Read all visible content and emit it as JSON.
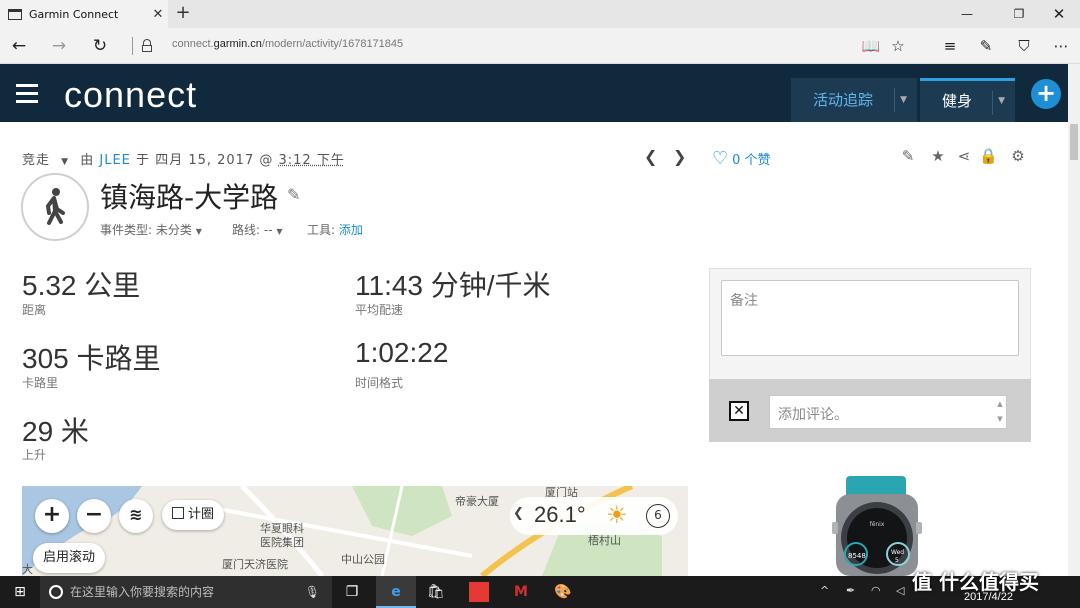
{
  "browser": {
    "tab_title": "Garmin Connect",
    "tab_close": "✕",
    "new_tab": "+",
    "url_prefix": "connect.",
    "url_host": "garmin.cn",
    "url_path": "/modern/activity/1678171845"
  },
  "header": {
    "logo_text": "connect",
    "tabs": [
      {
        "label": "活动追踪"
      },
      {
        "label": "健身"
      }
    ]
  },
  "activity": {
    "type": "竞走",
    "by_label": "由",
    "user": "JLEE",
    "on_label": "于",
    "date": "四月 15, 2017",
    "at": "@",
    "time": "3:12 下午",
    "likes": "0 个赞",
    "title": "镇海路-大学路",
    "event_type_label": "事件类型:",
    "event_type_value": "未分类",
    "course_label": "路线:",
    "course_value": "--",
    "gear_label": "工具:",
    "gear_value": "添加"
  },
  "stats": [
    {
      "value": "5.32 公里",
      "label": "距离"
    },
    {
      "value": "11:43 分钟/千米",
      "label": "平均配速"
    },
    {
      "value": "305 卡路里",
      "label": "卡路里"
    },
    {
      "value": "1:02:22",
      "label": "时间格式"
    },
    {
      "value": "29 米",
      "label": "上升"
    }
  ],
  "notes": {
    "placeholder": "备注",
    "comment_placeholder": "添加评论。"
  },
  "map": {
    "toggle_label": "计圈",
    "scroll_label": "启用滚动",
    "temperature": "26.1°",
    "wind": "6",
    "places": [
      "帝豪大厦",
      "厦门站",
      "华夏眼科",
      "医院集团",
      "梧村山",
      "中山公园",
      "厦门天济医院",
      "大"
    ]
  },
  "taskbar": {
    "search_placeholder": "在这里输入你要搜索的内容",
    "date": "2017/4/22"
  },
  "watermark": "值 什么值得买",
  "watch": {
    "brand": "fēnix",
    "steps": "8548",
    "day": "Wed",
    "date_num": "5"
  },
  "colors": {
    "header_bg": "#11293d",
    "accent": "#1a8bd3",
    "plus_button": "#1e8fd5"
  }
}
